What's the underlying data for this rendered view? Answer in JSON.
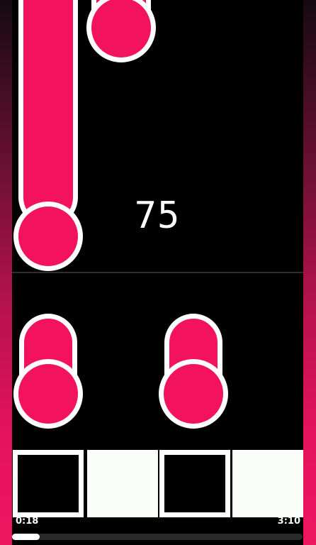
{
  "game": {
    "score": "75",
    "lanes": 4
  },
  "progress": {
    "elapsed": "0:18",
    "total": "3:10",
    "fraction": 0.095
  },
  "colors": {
    "note": "#f2125d",
    "note_outline": "#ffffff",
    "rail_top": "#160a10",
    "rail_bottom": "#ef155f",
    "key_light": "#fbfdf8",
    "key_dark": "#000000"
  },
  "keys": [
    {
      "state": "idle"
    },
    {
      "state": "pressed"
    },
    {
      "state": "idle"
    },
    {
      "state": "pressed"
    }
  ]
}
